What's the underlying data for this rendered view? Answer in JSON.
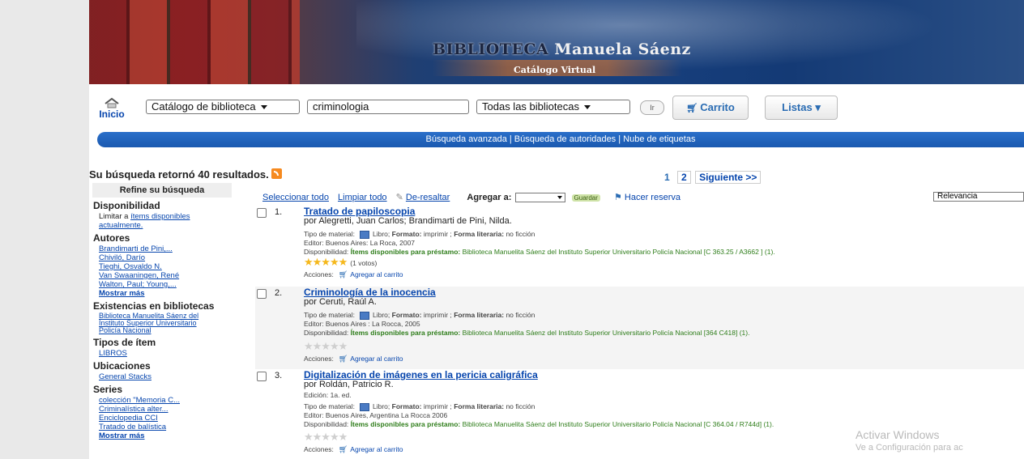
{
  "banner": {
    "title_part1": "BIBLIOTECA",
    "title_part2": "Manuela Sáenz",
    "subtitle": "Catálogo Virtual"
  },
  "header": {
    "home_label": "Inicio",
    "catalog_select": "Catálogo de biblioteca",
    "search_value": "criminologia",
    "library_select": "Todas las bibliotecas",
    "go_button": "Ir",
    "cart_button": "Carrito",
    "lists_button": "Listas ▾"
  },
  "navbar": {
    "text": "Búsqueda avanzada | Búsqueda de autoridades | Nube de etiquetas"
  },
  "results_summary": "Su búsqueda retornó 40 resultados.",
  "pagination": {
    "page1": "1",
    "page2": "2",
    "next": "Siguiente >>"
  },
  "sidebar": {
    "header": "Refine su búsqueda",
    "availability": {
      "heading": "Disponibilidad",
      "text1": "Limitar a",
      "link": "ítems disponibles actualmente."
    },
    "authors": {
      "heading": "Autores",
      "items": [
        "Brandimarti de Pini,...",
        "Chiviló, Darío",
        "Tieghi, Osvaldo N.",
        "Van Swaaningen, René",
        "Walton, Paul; Young,..."
      ],
      "more": "Mostrar más"
    },
    "holdings": {
      "heading": "Existencias en bibliotecas",
      "link": "Biblioteca Manuelita Sáenz del Instituto Superior Universitario Policía Nacional"
    },
    "item_types": {
      "heading": "Tipos de ítem",
      "items": [
        "LIBROS"
      ]
    },
    "locations": {
      "heading": "Ubicaciones",
      "items": [
        "General Stacks"
      ]
    },
    "series": {
      "heading": "Series",
      "items": [
        "colección \"Memoria C...",
        "Criminalística alter...",
        "Enciclopedia CCI",
        "Tratado de balística"
      ],
      "more": "Mostrar más"
    }
  },
  "toolbar": {
    "select_all": "Seleccionar todo",
    "clear_all": "Limpiar todo",
    "unhighlight": "De-resaltar",
    "add_to": "Agregar a:",
    "save": "Guardar",
    "hold": "Hacer reserva",
    "sort": "Relevancia"
  },
  "labels": {
    "material_type": "Tipo de material:",
    "book": "Libro;",
    "format": "Formato:",
    "format_value": "imprimir ;",
    "literary_form": "Forma literaria:",
    "literary_value": "no ficción",
    "availability": "Disponibilidad:",
    "items_available": "Ítems disponibles para préstamo:",
    "actions": "Acciones:",
    "add_to_cart": "Agregar al carrito",
    "edition": "Edición:"
  },
  "results": [
    {
      "num": "1.",
      "title": "Tratado de papiloscopia",
      "author": "por Alegretti, Juan Carlos; Brandimarti de Pini, Nilda.",
      "publisher": "Editor: Buenos Aires: La Roca, 2007",
      "availability": "Biblioteca Manuelita Sáenz del Instituto Superior Universitario Policía Nacional [C 363.25 / A3662 ] (1).",
      "rating": 5,
      "votes": "(1 votos)"
    },
    {
      "num": "2.",
      "title": "Criminología de la inocencia",
      "author": "por Ceruti, Raúl A.",
      "publisher": "Editor: Buenos Aires : La Rocca, 2005",
      "availability": "Biblioteca Manuelita Sáenz del Instituto Superior Universitario Policía Nacional [364 C418] (1).",
      "rating": 0,
      "votes": ""
    },
    {
      "num": "3.",
      "title": "Digitalización de imágenes en la pericia caligráfica",
      "author": "por Roldán, Patricio R.",
      "edition": "1a. ed.",
      "publisher": "Editor: Buenos Aires, Argentina La Rocca 2006",
      "availability": "Biblioteca Manuelita Sáenz del Instituto Superior Universitario Policía Nacional [C 364.04 / R744d] (1).",
      "rating": 0,
      "votes": ""
    }
  ],
  "watermark": {
    "line1": "Activar Windows",
    "line2": "Ve a Configuración para ac"
  }
}
